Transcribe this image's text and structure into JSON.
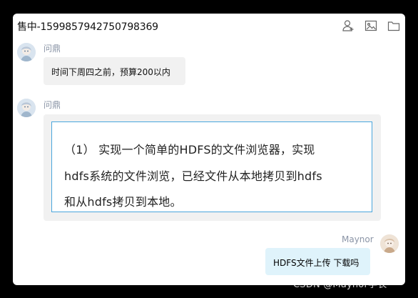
{
  "window": {
    "title": "售中-1599857942750798369",
    "icons": [
      "add-user-icon",
      "image-icon",
      "folder-icon"
    ]
  },
  "messages": [
    {
      "sender": "问鼎",
      "side": "left",
      "text": "时间下周四之前，预算200以内"
    },
    {
      "sender": "问鼎",
      "side": "left",
      "quote_lines": [
        "（1） 实现一个简单的HDFS的文件浏览器，实现",
        "hdfs系统的文件浏览，已经文件从本地拷贝到hdfs",
        "和从hdfs拷贝到本地。"
      ]
    },
    {
      "sender": "Maynor",
      "side": "right",
      "text": "HDFS文件上传 下载吗"
    }
  ],
  "watermark": "CSDN @Maynor学长",
  "colors": {
    "right_bubble": "#dff3fb",
    "left_bubble": "#f1f1f1",
    "quote_border": "#4aa6dd"
  }
}
